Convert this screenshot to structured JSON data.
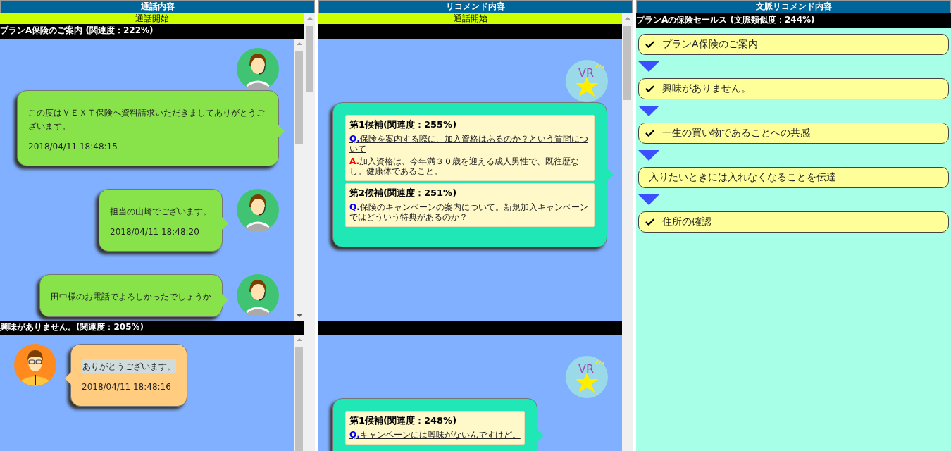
{
  "call_panel": {
    "header": "通話内容",
    "start_label": "通話開始",
    "sections": [
      {
        "title": "プランA保険のご案内 (関連度：222%)",
        "messages": [
          {
            "kind": "agent",
            "text": "この度はＶＥＸＴ保険へ資料請求いただきましてありがとうございます。",
            "time": "2018/04/11 18:48:15",
            "highlighted": false
          },
          {
            "kind": "agent",
            "text": "担当の山崎でございます。",
            "time": "2018/04/11 18:48:20",
            "highlighted": false
          },
          {
            "kind": "agent",
            "text": "田中様のお電話でよろしかったでしょうか",
            "highlighted": false
          }
        ]
      },
      {
        "title": "興味がありません。(関連度：205%)",
        "messages": [
          {
            "kind": "customer",
            "text": "ありがとうございます。",
            "time": "2018/04/11 18:48:16",
            "highlighted": true
          }
        ]
      }
    ]
  },
  "recommend_panel": {
    "header": "リコメンド内容",
    "start_label": "通話開始",
    "sections": [
      {
        "badge": "VR",
        "candidates": [
          {
            "heading": "第1候補(関連度：255%)",
            "q_label": "Q.",
            "question": "保険を案内する際に、加入資格はあるのか？という質問について",
            "a_label": "A.",
            "answer": "加入資格は、今年満３０歳を迎える成人男性で、既往歴なし。健康体であること。"
          },
          {
            "heading": "第2候補(関連度：251%)",
            "q_label": "Q.",
            "question": "保険のキャンペーンの案内について。新規加入キャンペーンではどういう特典があるのか？"
          }
        ]
      },
      {
        "badge": "VR",
        "candidates": [
          {
            "heading": "第1候補(関連度：248%)",
            "q_label": "Q.",
            "question": "キャンペーンには興味がないんですけど。"
          }
        ]
      }
    ]
  },
  "context_panel": {
    "header": "文脈リコメンド内容",
    "title": "プランAの保険セールス (文脈類似度：244%)",
    "steps": [
      {
        "label": "プランA保険のご案内",
        "checked": true
      },
      {
        "label": "興味がありません。",
        "checked": true
      },
      {
        "label": "一生の買い物であることへの共感",
        "checked": true
      },
      {
        "label": "入りたいときには入れなくなることを伝達",
        "checked": false
      },
      {
        "label": "住所の確認",
        "checked": true
      }
    ]
  }
}
